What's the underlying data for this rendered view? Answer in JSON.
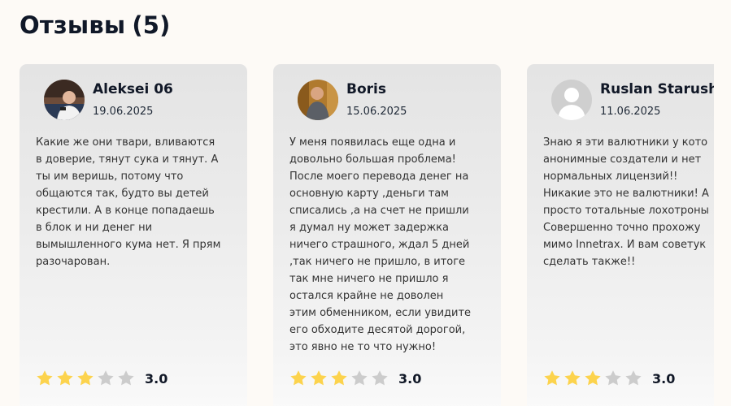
{
  "heading": {
    "label": "Отзывы",
    "count": "(5)"
  },
  "colors": {
    "star_filled": "#fcd34d",
    "star_empty": "#cccccc"
  },
  "reviews": [
    {
      "name": "Aleksei 06",
      "date": "19.06.2025",
      "avatar": "user-photo",
      "lines": [
        "Какие же они твари, вливаются",
        "в доверие, тянут сука и тянут. А",
        "ты им веришь, потому что",
        "общаются так, будто вы детей",
        "крестили. А в конце попадаешь",
        "в блок и ни денег ни",
        "вымышленного кума нет. Я прям",
        "разочарован."
      ],
      "stars": 3,
      "score": "3.0"
    },
    {
      "name": "Boris",
      "date": "15.06.2025",
      "avatar": "user-photo",
      "lines": [
        "У меня появилась еще одна и",
        "довольно большая проблема!",
        "После моего перевода денег на",
        "основную карту ,деньги там",
        "списались ,а на счет не пришли",
        "я думал ну может задержка",
        "ничего страшного, ждал 5 дней",
        ",так ничего не пришло, в итоге",
        "так мне ничего не пришло я",
        "остался крайне не доволен",
        "этим обменником, если увидите",
        "его обходите десятой дорогой,",
        "это явно не то что нужно!"
      ],
      "stars": 3,
      "score": "3.0"
    },
    {
      "name": "Ruslan Starush",
      "date": "11.06.2025",
      "avatar": "default-user",
      "lines": [
        "Знаю я эти валютники у кото",
        "анонимные создатели и нет",
        "нормальных лицензий!!",
        "Никакие это не валютники! А",
        "просто тотальные лохотроны",
        "Совершенно точно прохожу",
        "мимо Innetrax. И вам советук",
        "сделать также!!"
      ],
      "stars": 3,
      "score": "3.0"
    }
  ]
}
